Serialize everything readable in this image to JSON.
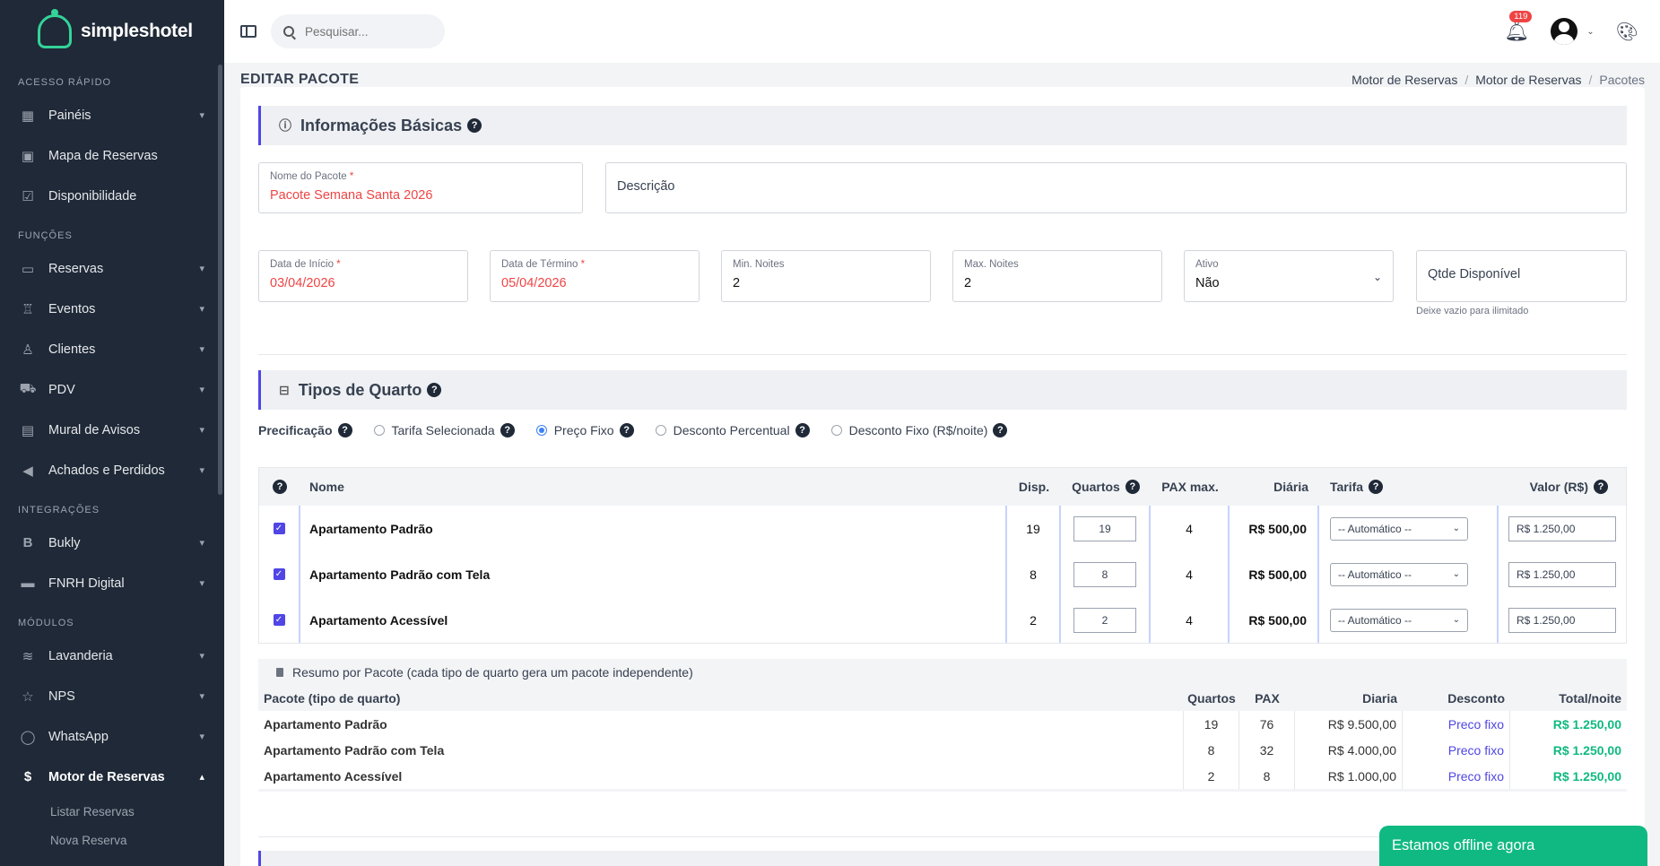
{
  "brand": {
    "name": "simpleshotel"
  },
  "sidebar": {
    "sections": [
      {
        "title": "ACESSO RÁPIDO"
      },
      {
        "title": "FUNÇÕES"
      },
      {
        "title": "INTEGRAÇÕES"
      },
      {
        "title": "MÓDULOS"
      }
    ],
    "items": [
      {
        "label": "Painéis",
        "icon": "dashboard-icon"
      },
      {
        "label": "Mapa de Reservas",
        "icon": "calendar-icon"
      },
      {
        "label": "Disponibilidade",
        "icon": "calendar-check-icon"
      },
      {
        "label": "Reservas",
        "icon": "bed-icon"
      },
      {
        "label": "Eventos",
        "icon": "podium-icon"
      },
      {
        "label": "Clientes",
        "icon": "user-icon"
      },
      {
        "label": "PDV",
        "icon": "cart-icon"
      },
      {
        "label": "Mural de Avisos",
        "icon": "bulletin-icon"
      },
      {
        "label": "Achados e Perdidos",
        "icon": "megaphone-icon"
      },
      {
        "label": "Bukly",
        "icon": "b-logo-icon"
      },
      {
        "label": "FNRH Digital",
        "icon": "id-card-icon"
      },
      {
        "label": "Lavanderia",
        "icon": "waves-icon"
      },
      {
        "label": "NPS",
        "icon": "star-icon"
      },
      {
        "label": "WhatsApp",
        "icon": "whatsapp-icon"
      },
      {
        "label": "Motor de Reservas",
        "icon": "dollar-circle-icon"
      }
    ],
    "sub_items": [
      {
        "label": "Listar Reservas"
      },
      {
        "label": "Nova Reserva"
      }
    ]
  },
  "topbar": {
    "search_placeholder": "Pesquisar...",
    "notification_count": "119"
  },
  "page": {
    "title": "EDITAR PACOTE",
    "breadcrumb": [
      "Motor de Reservas",
      "Motor de Reservas",
      "Pacotes"
    ]
  },
  "basic": {
    "heading": "Informações Básicas",
    "name_label": "Nome do Pacote",
    "name_value": "Pacote Semana Santa 2026",
    "desc_placeholder": "Descrição",
    "start_label": "Data de Início",
    "start_value": "03/04/2026",
    "end_label": "Data de Término",
    "end_value": "05/04/2026",
    "min_label": "Min. Noites",
    "min_value": "2",
    "max_label": "Max. Noites",
    "max_value": "2",
    "active_label": "Ativo",
    "active_value": "Não",
    "qty_placeholder": "Qtde Disponível",
    "qty_hint": "Deixe vazio para ilimitado",
    "required_mark": "*"
  },
  "rooms": {
    "heading": "Tipos de Quarto",
    "pricing_label": "Precificação",
    "pricing_options": [
      {
        "label": "Tarifa Selecionada",
        "selected": false
      },
      {
        "label": "Preço Fixo",
        "selected": true
      },
      {
        "label": "Desconto Percentual",
        "selected": false
      },
      {
        "label": "Desconto Fixo (R$/noite)",
        "selected": false
      }
    ],
    "columns": {
      "name": "Nome",
      "disp": "Disp.",
      "rooms": "Quartos",
      "pax": "PAX max.",
      "daily": "Diária",
      "rate": "Tarifa",
      "value": "Valor (R$)"
    },
    "rows": [
      {
        "name": "Apartamento Padrão",
        "disp": "19",
        "rooms": "19",
        "pax": "4",
        "daily": "R$ 500,00",
        "rate": "-- Automático --",
        "value": "R$ 1.250,00"
      },
      {
        "name": "Apartamento Padrão com Tela",
        "disp": "8",
        "rooms": "8",
        "pax": "4",
        "daily": "R$ 500,00",
        "rate": "-- Automático --",
        "value": "R$ 1.250,00"
      },
      {
        "name": "Apartamento Acessível",
        "disp": "2",
        "rooms": "2",
        "pax": "4",
        "daily": "R$ 500,00",
        "rate": "-- Automático --",
        "value": "R$ 1.250,00"
      }
    ]
  },
  "summary": {
    "title": "Resumo por Pacote (cada tipo de quarto gera um pacote independente)",
    "columns": {
      "name": "Pacote (tipo de quarto)",
      "rooms": "Quartos",
      "pax": "PAX",
      "daily": "Diaria",
      "discount": "Desconto",
      "total": "Total/noite"
    },
    "rows": [
      {
        "name": "Apartamento Padrão",
        "rooms": "19",
        "pax": "76",
        "daily": "R$ 9.500,00",
        "discount": "Preco fixo",
        "total": "R$ 1.250,00"
      },
      {
        "name": "Apartamento Padrão com Tela",
        "rooms": "8",
        "pax": "32",
        "daily": "R$ 4.000,00",
        "discount": "Preco fixo",
        "total": "R$ 1.250,00"
      },
      {
        "name": "Apartamento Acessível",
        "rooms": "2",
        "pax": "8",
        "daily": "R$ 1.000,00",
        "discount": "Preco fixo",
        "total": "R$ 1.250,00"
      }
    ]
  },
  "chat": {
    "status": "Estamos offline agora"
  },
  "colors": {
    "accent": "#4f46e5",
    "success": "#10b981",
    "required": "#ef4444",
    "sidebar": "#1f2937"
  }
}
